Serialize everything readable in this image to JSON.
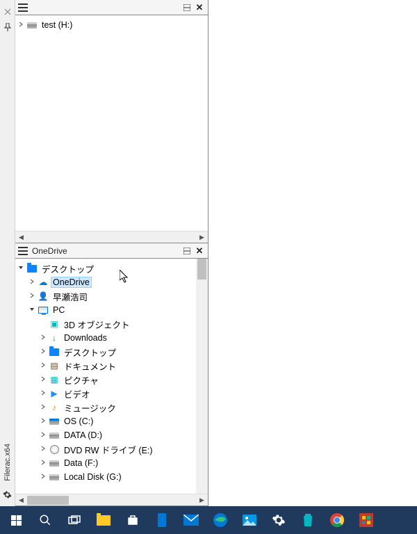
{
  "leftRail": {
    "appName": "Filerac.x64"
  },
  "topPane": {
    "title": "",
    "tree": [
      {
        "label": "test (H:)",
        "depth": 0,
        "expander": ">",
        "icon": "drive"
      }
    ]
  },
  "bottomPane": {
    "title": "OneDrive",
    "tree": [
      {
        "label": "デスクトップ",
        "depth": 0,
        "expander": "v",
        "icon": "folder-blue",
        "selected": false
      },
      {
        "label": "OneDrive",
        "depth": 1,
        "expander": ">",
        "icon": "cloud",
        "selected": true
      },
      {
        "label": "早瀬浩司",
        "depth": 1,
        "expander": ">",
        "icon": "user",
        "selected": false
      },
      {
        "label": "PC",
        "depth": 1,
        "expander": "v",
        "icon": "monitor",
        "selected": false
      },
      {
        "label": "3D オブジェクト",
        "depth": 2,
        "expander": "",
        "icon": "3d",
        "selected": false
      },
      {
        "label": "Downloads",
        "depth": 2,
        "expander": ">",
        "icon": "download",
        "selected": false
      },
      {
        "label": "デスクトップ",
        "depth": 2,
        "expander": ">",
        "icon": "folder-blue",
        "selected": false
      },
      {
        "label": "ドキュメント",
        "depth": 2,
        "expander": ">",
        "icon": "document",
        "selected": false
      },
      {
        "label": "ピクチャ",
        "depth": 2,
        "expander": ">",
        "icon": "picture",
        "selected": false
      },
      {
        "label": "ビデオ",
        "depth": 2,
        "expander": ">",
        "icon": "video",
        "selected": false
      },
      {
        "label": "ミュージック",
        "depth": 2,
        "expander": ">",
        "icon": "music",
        "selected": false
      },
      {
        "label": "OS (C:)",
        "depth": 2,
        "expander": ">",
        "icon": "drive-os",
        "selected": false
      },
      {
        "label": "DATA (D:)",
        "depth": 2,
        "expander": ">",
        "icon": "drive",
        "selected": false
      },
      {
        "label": "DVD RW ドライブ (E:)",
        "depth": 2,
        "expander": ">",
        "icon": "dvd",
        "selected": false
      },
      {
        "label": "Data (F:)",
        "depth": 2,
        "expander": ">",
        "icon": "drive",
        "selected": false
      },
      {
        "label": "Local Disk (G:)",
        "depth": 2,
        "expander": ">",
        "icon": "drive",
        "selected": false
      }
    ]
  },
  "taskbar": {
    "items": [
      "start",
      "search",
      "taskview",
      "explorer",
      "store",
      "phone",
      "mail",
      "edge",
      "photos",
      "settings",
      "recycle",
      "chrome",
      "app"
    ]
  }
}
